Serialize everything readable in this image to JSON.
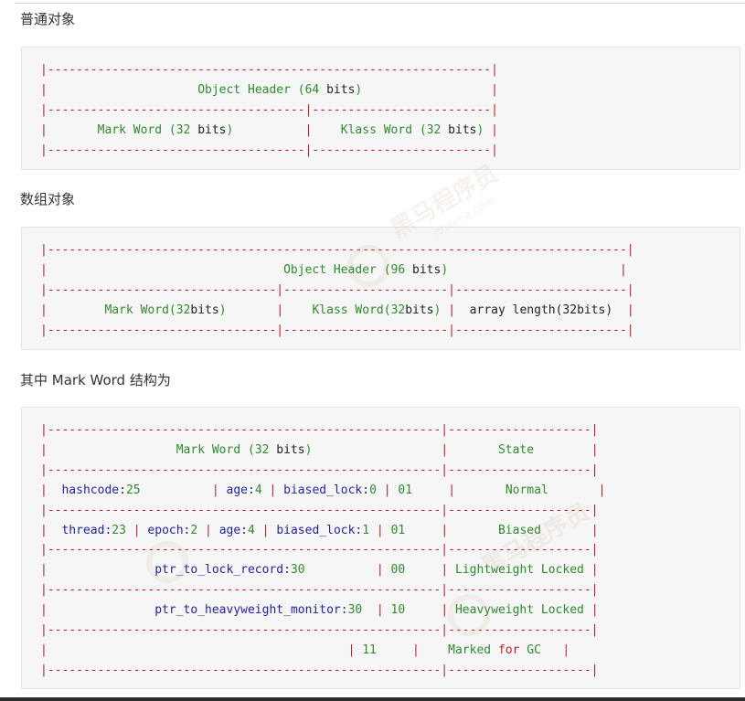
{
  "headings": {
    "normal_object": "普通对象",
    "array_object": "数组对象",
    "mark_word_structure": "其中 Mark Word 结构为"
  },
  "normal_object": {
    "object_header": "Object Header (64 bits)",
    "mark_word": "Mark Word (32 bits)",
    "klass_word": "Klass Word (32 bits)"
  },
  "array_object": {
    "object_header": "Object Header (96 bits)",
    "mark_word": "Mark Word(32bits)",
    "klass_word": "Klass Word(32bits)",
    "array_length": "array length(32bits)"
  },
  "mark_word_table": {
    "header": {
      "mark_word": "Mark Word (32 bits)",
      "state": "State"
    },
    "rows": [
      {
        "fields": "hashcode:25          | age:4 | biased_lock:0",
        "bits": "01",
        "state": "Normal"
      },
      {
        "fields": "thread:23 | epoch:2 | age:4 | biased_lock:1",
        "bits": "01",
        "state": "Biased"
      },
      {
        "fields": "ptr_to_lock_record:30",
        "bits": "00",
        "state": "Lightweight Locked"
      },
      {
        "fields": "ptr_to_heavyweight_monitor:30",
        "bits": "10",
        "state": "Heavyweight Locked"
      },
      {
        "fields": "",
        "bits": "11",
        "state": "Marked for GC"
      }
    ]
  },
  "watermark": {
    "text": "黑马程序员",
    "subtext": "itheima.com"
  }
}
